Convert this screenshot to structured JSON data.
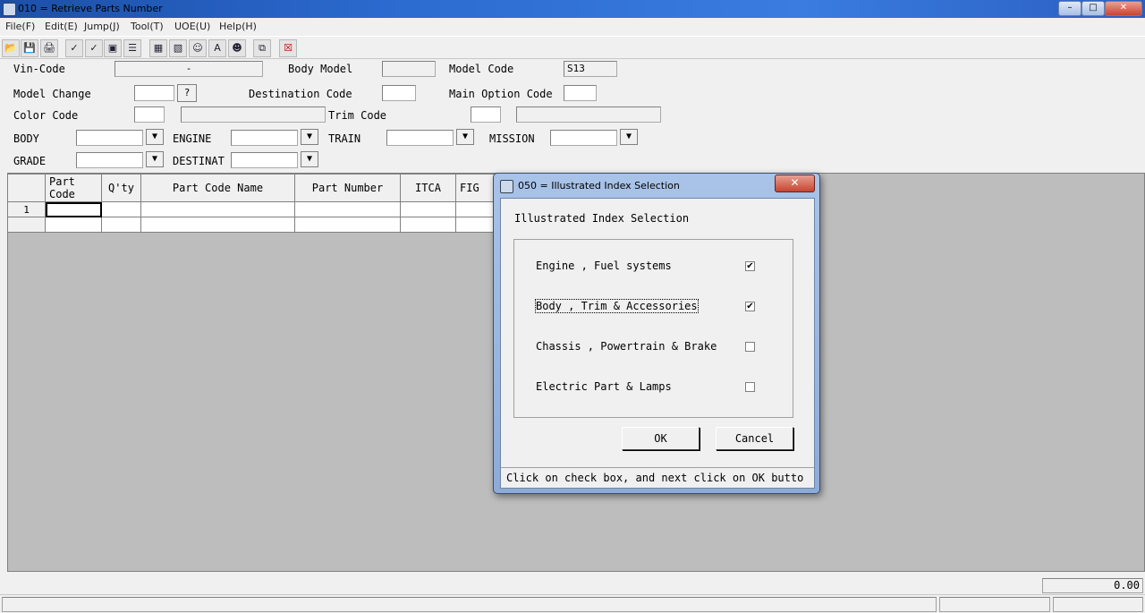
{
  "window": {
    "title": "010 = Retrieve Parts Number",
    "minimize": "–",
    "maximize": "□",
    "close": "✕"
  },
  "menu": [
    "File(F)",
    "Edit(E)",
    "Jump(J)",
    "Tool(T)",
    "UOE(U)",
    "Help(H)"
  ],
  "toolbar": {
    "icons": [
      "open-icon",
      "save-icon",
      "print-icon",
      "check-123-icon",
      "check-009-icon",
      "save-list-icon",
      "list-icon",
      "table-icon",
      "copy-table-icon",
      "person-search-icon",
      "text-edit-icon",
      "person-lock-icon",
      "window-copy-icon",
      "close-document-icon"
    ],
    "glyphs": [
      "📂",
      "💾",
      "🖨",
      "✓",
      "✓",
      "▣",
      "☰",
      "▦",
      "▧",
      "☺",
      "A",
      "☻",
      "⧉",
      "☒"
    ]
  },
  "form": {
    "vin_code_label": "Vin-Code",
    "vin_code_value": "-",
    "body_model_label": "Body Model",
    "body_model_value": "",
    "model_code_label": "Model Code",
    "model_code_value": "S13",
    "model_change_label": "Model Change",
    "model_change_value": "",
    "help_button": "?",
    "destination_code_label": "Destination Code",
    "destination_code_value": "",
    "main_option_code_label": "Main Option Code",
    "main_option_code_value": "",
    "color_code_label": "Color Code",
    "trim_code_label": "Trim Code",
    "body_label": "BODY",
    "engine_label": "ENGINE",
    "train_label": "TRAIN",
    "mission_label": "MISSION",
    "grade_label": "GRADE",
    "destinat_label": "DESTINAT",
    "dropdown_arrow": "▼"
  },
  "grid": {
    "headers": [
      "Part Code",
      "Q'ty",
      "Part Code Name",
      "Part Number",
      "ITCA",
      "FIG"
    ],
    "rows": [
      {
        "num": "1",
        "cells": [
          "",
          "",
          "",
          "",
          "",
          ""
        ]
      },
      {
        "num": "",
        "cells": [
          "",
          "",
          "",
          "",
          "",
          ""
        ]
      }
    ]
  },
  "dialog": {
    "title": "050 = Illustrated Index Selection",
    "close": "✕",
    "heading": "Illustrated Index Selection",
    "options": [
      {
        "label": "Engine , Fuel systems",
        "checked": true,
        "mark": "✔"
      },
      {
        "label": "Body , Trim & Accessories",
        "checked": true,
        "mark": "✔"
      },
      {
        "label": "Chassis , Powertrain & Brake",
        "checked": false,
        "mark": ""
      },
      {
        "label": "Electric Part & Lamps",
        "checked": false,
        "mark": ""
      }
    ],
    "ok": "OK",
    "cancel": "Cancel",
    "status": "Click on check box, and next click on OK butto"
  },
  "status": {
    "total": "0.00"
  }
}
